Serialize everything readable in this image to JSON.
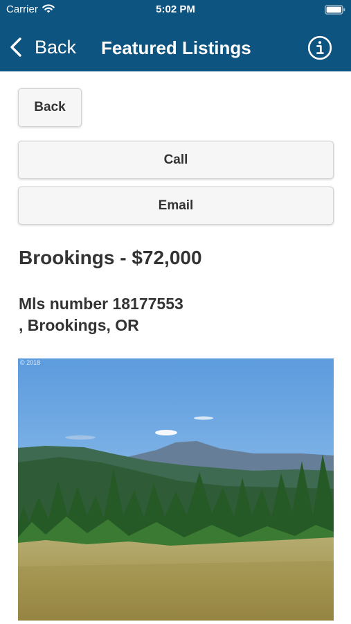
{
  "status_bar": {
    "carrier": "Carrier",
    "time": "5:02 PM",
    "icons": [
      "wifi-icon",
      "battery-icon"
    ]
  },
  "nav": {
    "back_label": "Back",
    "title": "Featured Listings",
    "icons": [
      "chevron-left-icon",
      "info-icon"
    ]
  },
  "actions": {
    "back_label": "Back",
    "call_label": "Call",
    "email_label": "Email"
  },
  "listing": {
    "title": "Brookings - $72,000",
    "mls": "Mls number 18177553",
    "location": ", Brookings, OR",
    "photo_copyright": "© 2018"
  },
  "colors": {
    "nav_background": "#0e5480",
    "button_background": "#f6f6f6",
    "text": "#333333"
  }
}
